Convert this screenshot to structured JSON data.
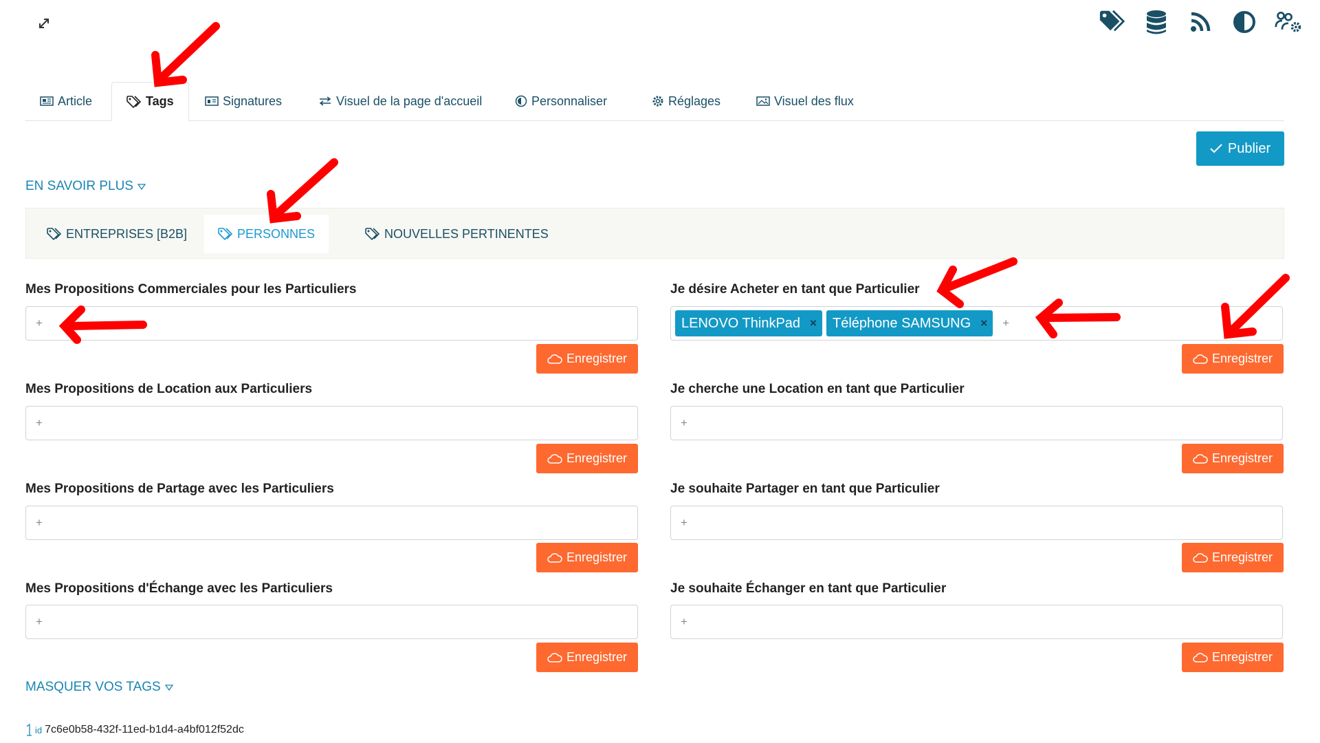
{
  "colors": {
    "accent": "#1399c6",
    "save": "#fe6930",
    "tab_text": "#1a4f66",
    "link": "#1a86b3",
    "annotation_arrow": "#ff0000"
  },
  "toolbar": {
    "expand_icon": "expand-icon",
    "icons": [
      "tags-icon",
      "database-icon",
      "rss-icon",
      "contrast-icon",
      "users-cog-icon"
    ]
  },
  "main_tabs": [
    {
      "label": "Article",
      "icon": "newspaper-icon"
    },
    {
      "label": "Tags",
      "icon": "tag-icon",
      "active": true
    },
    {
      "label": "Signatures",
      "icon": "id-card-icon"
    },
    {
      "label": "Visuel de la page d'accueil",
      "icon": "exchange-icon"
    },
    {
      "label": "Personnaliser",
      "icon": "copyright-icon"
    },
    {
      "label": "Réglages",
      "icon": "gear-icon"
    },
    {
      "label": "Visuel des flux",
      "icon": "image-icon"
    }
  ],
  "publish": {
    "label": "Publier"
  },
  "learn_more": {
    "label": "EN SAVOIR PLUS"
  },
  "sub_tabs": [
    {
      "label": "ENTREPRISES [B2B]"
    },
    {
      "label": "PERSONNES",
      "active": true
    },
    {
      "label": "NOUVELLES PERTINENTES"
    }
  ],
  "fields": {
    "left": [
      {
        "label": "Mes Propositions Commerciales pour les Particuliers",
        "tags": [],
        "placeholder": "+",
        "save_label": "Enregistrer"
      },
      {
        "label": "Mes Propositions de Location aux Particuliers",
        "tags": [],
        "placeholder": "+",
        "save_label": "Enregistrer"
      },
      {
        "label": "Mes Propositions de Partage avec les Particuliers",
        "tags": [],
        "placeholder": "+",
        "save_label": "Enregistrer"
      },
      {
        "label": "Mes Propositions d'Échange avec les Particuliers",
        "tags": [],
        "placeholder": "+",
        "save_label": "Enregistrer"
      }
    ],
    "right": [
      {
        "label": "Je désire Acheter en tant que Particulier",
        "tags": [
          "LENOVO ThinkPad",
          "Téléphone SAMSUNG"
        ],
        "placeholder": "+",
        "save_label": "Enregistrer"
      },
      {
        "label": "Je cherche une Location en tant que Particulier",
        "tags": [],
        "placeholder": "+",
        "save_label": "Enregistrer"
      },
      {
        "label": "Je souhaite Partager en tant que Particulier",
        "tags": [],
        "placeholder": "+",
        "save_label": "Enregistrer"
      },
      {
        "label": "Je souhaite Échanger en tant que Particulier",
        "tags": [],
        "placeholder": "+",
        "save_label": "Enregistrer"
      }
    ]
  },
  "hide_tags": {
    "label": "MASQUER VOS TAGS"
  },
  "record_id": {
    "prefix": "id",
    "value": "7c6e0b58-432f-11ed-b1d4-a4bf012f52dc"
  },
  "tag_remove_glyph": "×"
}
